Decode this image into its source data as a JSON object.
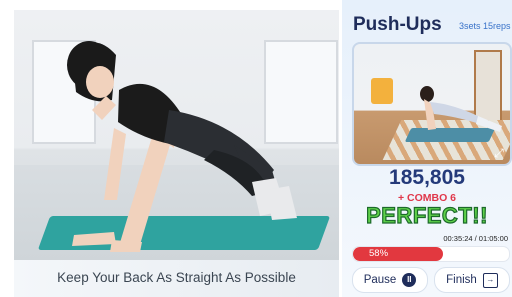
{
  "workout": {
    "exercise_name": "Push-Ups",
    "sets_reps": "3sets 15reps",
    "caption": "Keep Your Back As Straight As Possible"
  },
  "score": {
    "value": "185,805",
    "combo_text": "+ COMBO 6",
    "rating": "PERFECT!!"
  },
  "progress": {
    "time_text": "00:35:24 / 01:05:00",
    "percent_text": "58%",
    "percent_value": 0.58
  },
  "controls": {
    "pause_label": "Pause",
    "finish_label": "Finish"
  },
  "colors": {
    "accent": "#1f2d5b",
    "progress_fill": "#e2383f",
    "rating": "#5fd14a"
  },
  "icons": {
    "pause": "pause-icon",
    "finish": "exit-icon",
    "fullscreen": "expand-icon"
  }
}
